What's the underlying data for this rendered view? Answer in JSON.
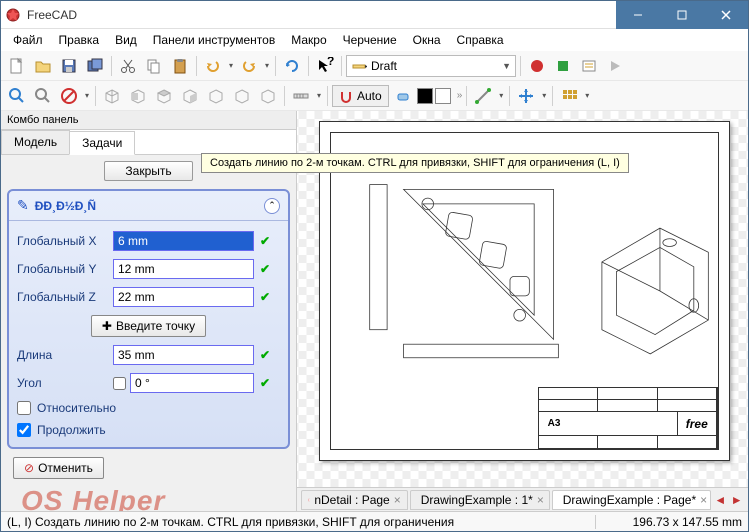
{
  "titlebar": {
    "title": "FreeCAD"
  },
  "menu": [
    "Файл",
    "Правка",
    "Вид",
    "Панели инструментов",
    "Макро",
    "Черчение",
    "Окна",
    "Справка"
  ],
  "mode_selector": {
    "label": "Draft"
  },
  "auto_button": {
    "label": "Auto"
  },
  "tooltip": "Создать линию по 2-м точкам. CTRL для привязки, SHIFT для ограничения (L, I)",
  "combo_panel": {
    "header": "Комбо панель",
    "tabs": [
      "Модель",
      "Задачи"
    ],
    "active_tab": 1,
    "close_label": "Закрыть",
    "task_title": "ÐÐ¸Ð½Ð¸Ñ",
    "fields": {
      "global_x_label": "Глобальный X",
      "global_x_value": "6 mm",
      "global_y_label": "Глобальный Y",
      "global_y_value": "12 mm",
      "global_z_label": "Глобальный Z",
      "global_z_value": "22 mm",
      "length_label": "Длина",
      "length_value": "35 mm",
      "angle_label": "Угол",
      "angle_value": "0 °"
    },
    "enter_point_btn": "Введите точку",
    "relative_label": "Относительно",
    "continue_label": "Продолжить",
    "cancel_label": "Отменить"
  },
  "doc_tabs": [
    {
      "label": "nDetail : Page",
      "active": false
    },
    {
      "label": "DrawingExample : 1*",
      "active": false
    },
    {
      "label": "DrawingExample : Page*",
      "active": true
    }
  ],
  "title_block": {
    "format": "A3",
    "logo": "free"
  },
  "statusbar": {
    "message": "(L, I) Создать линию по 2-м точкам. CTRL для привязки, SHIFT для ограничения",
    "coords": "196.73 x 147.55 mm"
  },
  "watermark": "OS Helper"
}
